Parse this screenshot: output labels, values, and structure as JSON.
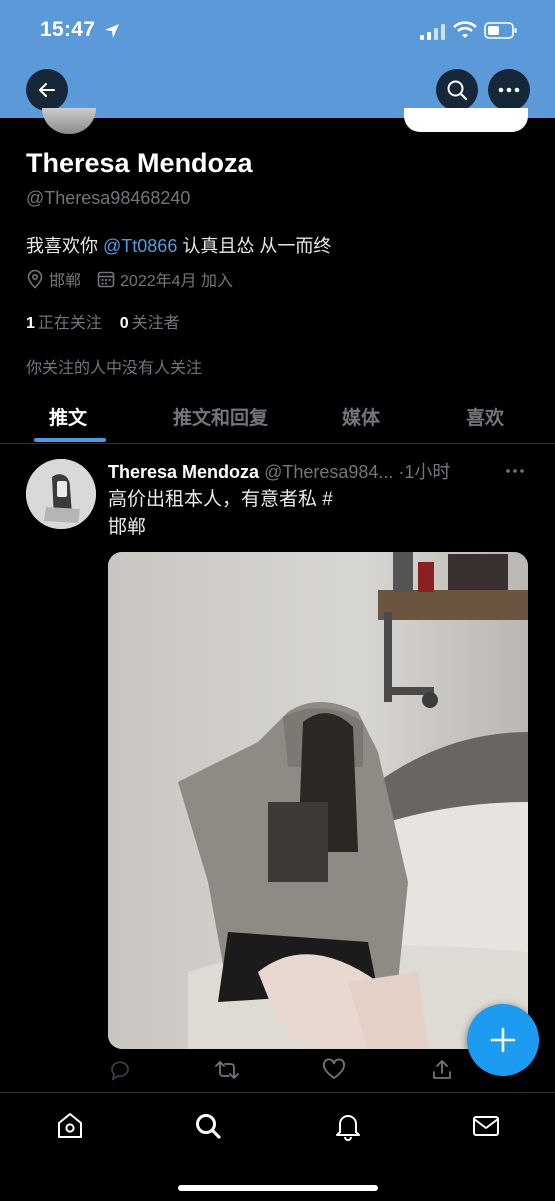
{
  "status_bar": {
    "time": "15:47"
  },
  "profile": {
    "name": "Theresa Mendoza",
    "handle": "@Theresa98468240",
    "bio_prefix": "我喜欢你 ",
    "bio_mention": "@Tt0866",
    "bio_suffix": " 认真且怂 从一而终",
    "location": "邯郸",
    "joined": "2022年4月 加入",
    "following_count": "1",
    "following_label": "正在关注",
    "followers_count": "0",
    "followers_label": "关注者",
    "followers_you_know": "你关注的人中没有人关注"
  },
  "tabs": [
    {
      "label": "推文",
      "active": true
    },
    {
      "label": "推文和回复",
      "active": false
    },
    {
      "label": "媒体",
      "active": false
    },
    {
      "label": "喜欢",
      "active": false
    }
  ],
  "tweet": {
    "author_name": "Theresa Mendoza",
    "author_handle": "@Theresa984...",
    "time": "·1小时",
    "text_line1": "高价出租本人，有意者私 #",
    "text_line2": "邯郸"
  },
  "colors": {
    "header_blue": "#5b99d8",
    "accent": "#1d9bf0",
    "mention": "#4d9de0",
    "background": "#000000"
  },
  "icons": {
    "back": "arrow-left-icon",
    "search": "search-icon",
    "more": "more-horizontal-icon",
    "location": "location-pin-icon",
    "calendar": "calendar-icon",
    "reply": "reply-icon",
    "retweet": "retweet-icon",
    "like": "heart-icon",
    "share": "share-icon",
    "compose": "plus-icon",
    "nav_home": "home-icon",
    "nav_search": "search-icon",
    "nav_notifications": "bell-icon",
    "nav_messages": "mail-icon"
  }
}
